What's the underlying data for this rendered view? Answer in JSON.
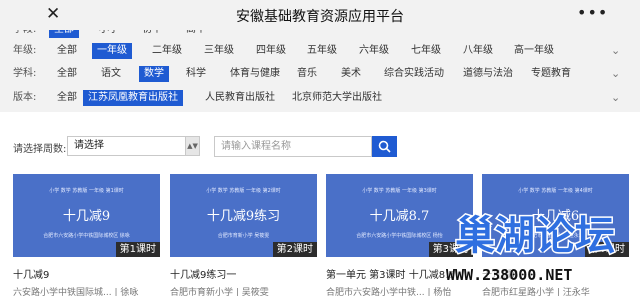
{
  "header": {
    "title": "安徽基础教育资源应用平台",
    "close_glyph": "✕",
    "more_glyph": "•••"
  },
  "filters": {
    "stage": {
      "label": "学段:",
      "options": [
        "全部",
        "小学",
        "初中",
        "高中"
      ],
      "selected": "全部"
    },
    "grade": {
      "label": "年级:",
      "options": [
        "全部",
        "一年级",
        "二年级",
        "三年级",
        "四年级",
        "五年级",
        "六年级",
        "七年级",
        "八年级",
        "高一年级"
      ],
      "selected": "一年级"
    },
    "subject": {
      "label": "学科:",
      "options": [
        "全部",
        "语文",
        "数学",
        "科学",
        "体育与健康",
        "音乐",
        "美术",
        "综合实践活动",
        "道德与法治",
        "专题教育"
      ],
      "selected": "数学"
    },
    "edition": {
      "label": "版本:",
      "options": [
        "全部",
        "江苏凤凰教育出版社",
        "人民教育出版社",
        "北京师范大学出版社"
      ],
      "selected": "江苏凤凰教育出版社"
    }
  },
  "week": {
    "label": "请选择周数:",
    "value": "请选择"
  },
  "search": {
    "placeholder": "请输入课程名称"
  },
  "courses": [
    {
      "cover_top": "小学 数学 苏教版 一年级 第1课时",
      "cover_title": "十几减9",
      "cover_school": "合肥市六安路小学中铁国际城校区 徐咏",
      "badge": "第1课时",
      "title": "十几减9",
      "meta": "六安路小学中铁国际城... | 徐咏"
    },
    {
      "cover_top": "小学 数学 苏教版 一年级 第2课时",
      "cover_title": "十几减9练习",
      "cover_school": "合肥市育新小学 吴筱雯",
      "badge": "第2课时",
      "title": "十几减9练习一",
      "meta": "合肥市育新小学 | 吴筱雯"
    },
    {
      "cover_top": "小学 数学 苏教版 一年级 第3课时",
      "cover_title": "十几减8.7",
      "cover_school": "合肥市六安路小学中铁国际城校区 杨怡",
      "badge": "第3课时",
      "title": "第一单元 第3课时 十几减8.7",
      "meta": "合肥市六安路小学中铁... | 杨怡"
    },
    {
      "cover_top": "小学 数学 苏教版 一年级 第4课时",
      "cover_title": "十几减6",
      "cover_school": "合肥市红星路小学 汪永华",
      "badge": "第4课时",
      "title": "十几减6",
      "meta": "合肥市红星路小学 | 汪永华"
    }
  ],
  "watermark": {
    "logo_text": "巢湖论坛",
    "url": "WWW.238000.NET"
  },
  "colors": {
    "accent": "#1f5bd2",
    "card_bg": "#4a70c8",
    "filter_bg": "#f2f2f2"
  }
}
